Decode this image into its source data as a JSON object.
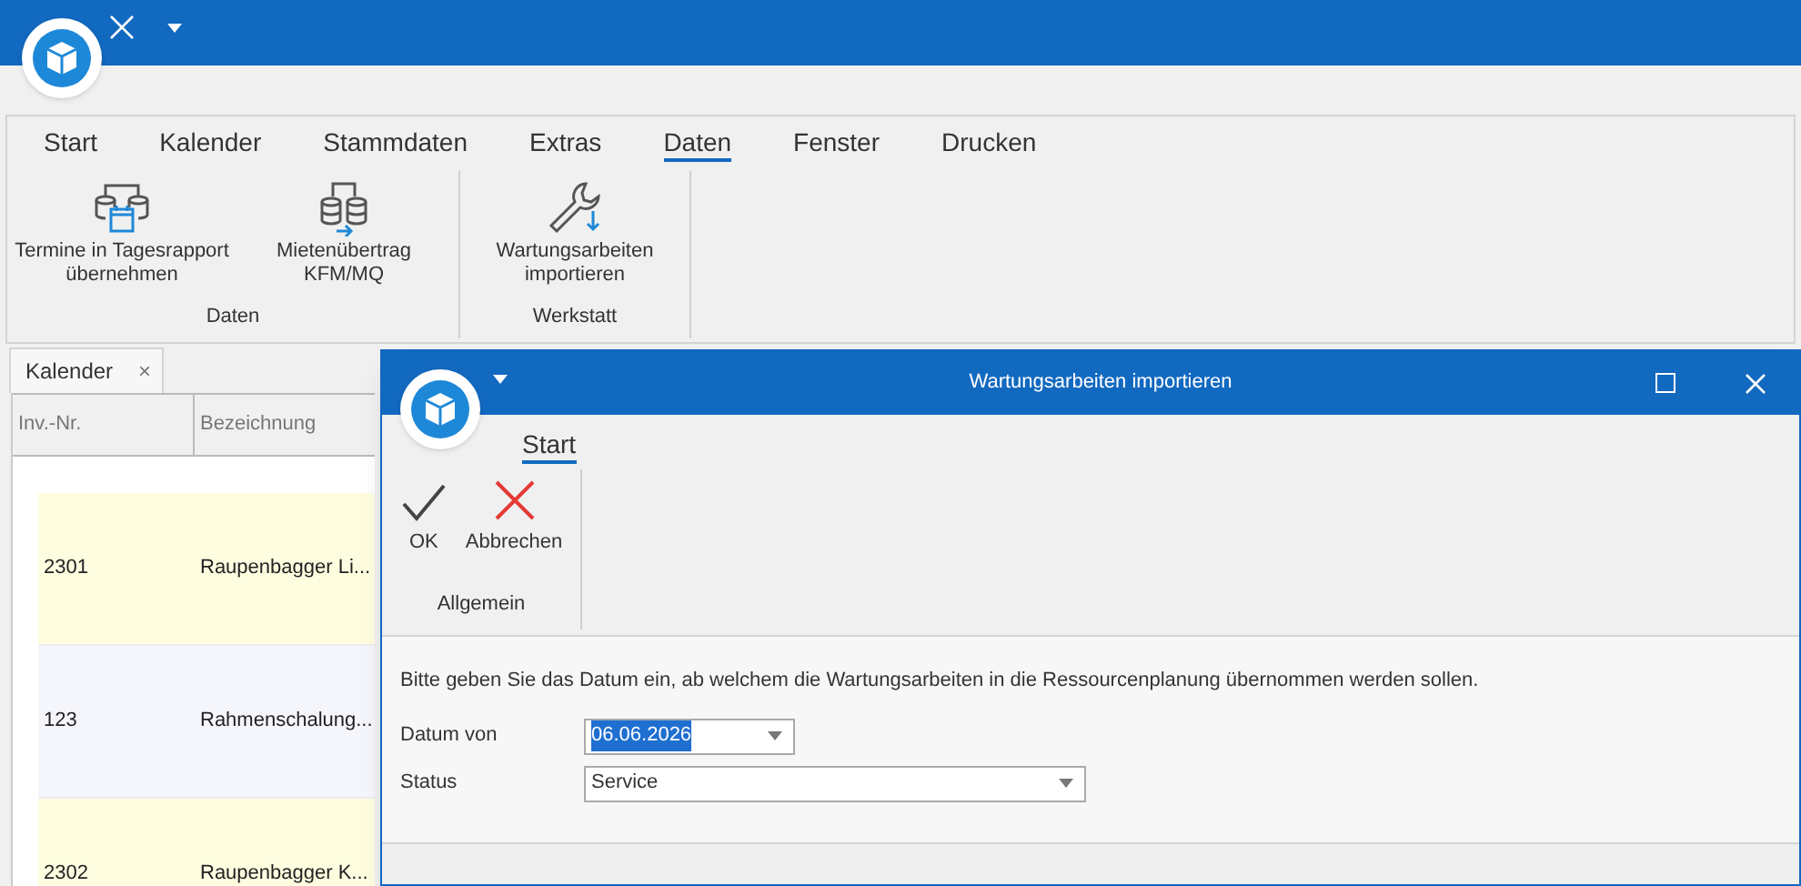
{
  "ribbon": {
    "tabs": [
      {
        "label": "Start",
        "selected": false
      },
      {
        "label": "Kalender",
        "selected": false
      },
      {
        "label": "Stammdaten",
        "selected": false
      },
      {
        "label": "Extras",
        "selected": false
      },
      {
        "label": "Daten",
        "selected": true
      },
      {
        "label": "Fenster",
        "selected": false
      },
      {
        "label": "Drucken",
        "selected": false
      }
    ],
    "groups": [
      {
        "label": "Daten",
        "buttons": [
          {
            "kind": "calendar-db",
            "label": "Termine in Tagesrapport übernehmen"
          },
          {
            "kind": "db-transfer",
            "label": "Mietenübertrag KFM/MQ"
          }
        ]
      },
      {
        "label": "Werkstatt",
        "buttons": [
          {
            "kind": "wrench",
            "label": "Wartungsarbeiten importieren"
          }
        ]
      }
    ]
  },
  "document_tab": {
    "label": "Kalender",
    "close": "×"
  },
  "grid": {
    "columns": [
      "Inv.-Nr.",
      "Bezeichnung"
    ],
    "rows": [
      {
        "cells": [
          "2301",
          "Raupenbagger Li..."
        ],
        "color": "#fefde0"
      },
      {
        "cells": [
          "123",
          "Rahmenschalung..."
        ],
        "color": "#f5f6fb"
      },
      {
        "cells": [
          "2302",
          "Raupenbagger K..."
        ],
        "color": "#fefde0"
      }
    ]
  },
  "dialog": {
    "title": "Wartungsarbeiten importieren",
    "tabs": [
      {
        "label": "Start",
        "selected": true
      }
    ],
    "group": {
      "label": "Allgemein",
      "buttons": [
        {
          "kind": "ok",
          "label": "OK"
        },
        {
          "kind": "cancel",
          "label": "Abbrechen"
        }
      ]
    },
    "instruction": "Bitte geben Sie das Datum ein, ab welchem die Wartungsarbeiten in die Ressourcenplanung übernommen werden sollen.",
    "fields": [
      {
        "label": "Datum von",
        "value": "06.06.2026",
        "selected": true
      },
      {
        "label": "Status",
        "value": "Service",
        "selected": false
      }
    ]
  }
}
